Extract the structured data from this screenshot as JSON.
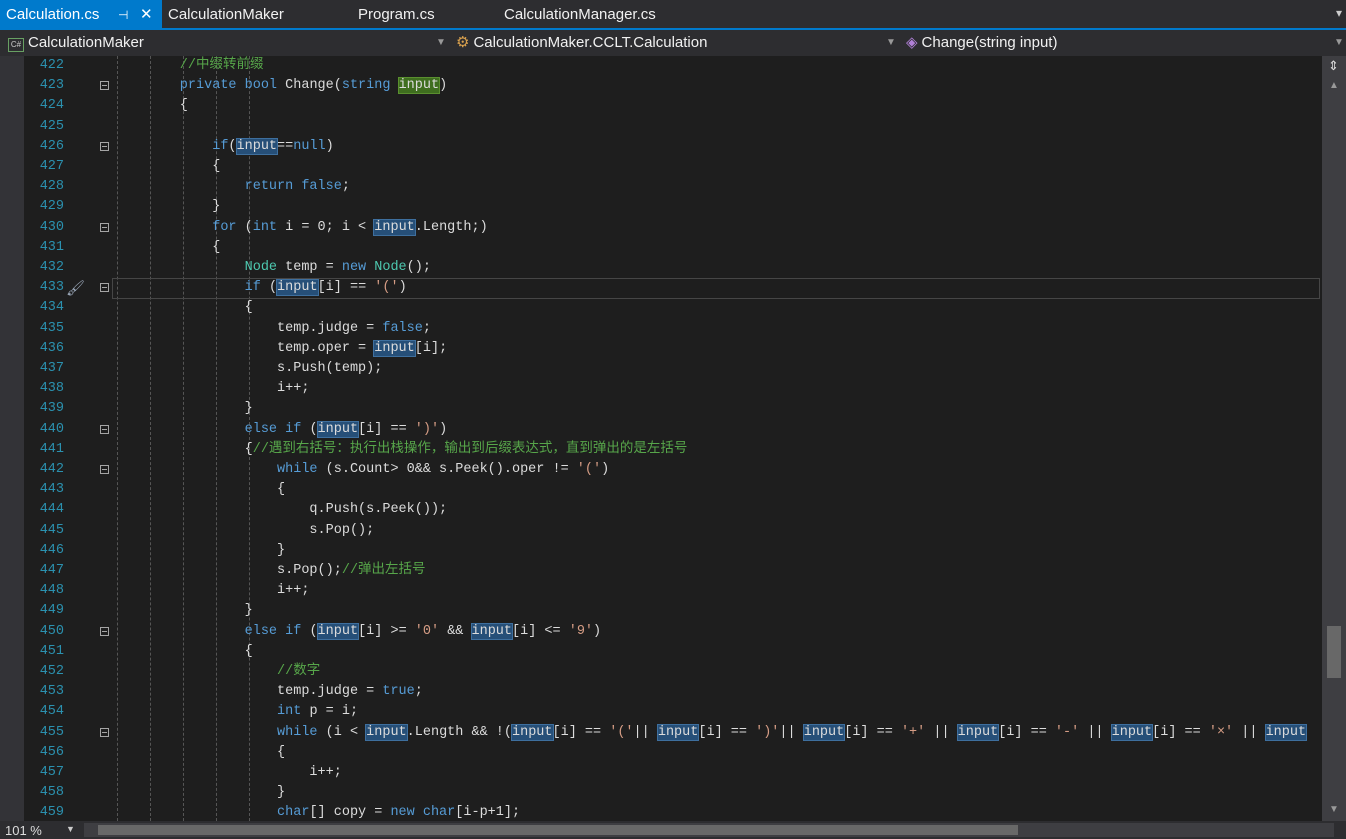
{
  "tabs": [
    {
      "label": "Calculation.cs",
      "active": true
    },
    {
      "label": "CalculationMaker"
    },
    {
      "label": "Program.cs"
    },
    {
      "label": "CalculationManager.cs"
    }
  ],
  "tab_icons": {
    "pin": "pin-icon",
    "close": "close-icon"
  },
  "navbar": {
    "project": "CalculationMaker",
    "class": "CalculationMaker.CCLT.Calculation",
    "member": "Change(string input)"
  },
  "colors": {
    "accent": "#007acc",
    "keyword": "#569cd6",
    "comment": "#57a64a",
    "type": "#4ec9b0",
    "string": "#d69d85",
    "line_number": "#2b91af"
  },
  "current_line": 433,
  "lines": [
    {
      "n": 422,
      "t": [
        [
          "c",
          "        //中缀转前缀"
        ]
      ]
    },
    {
      "n": 423,
      "f": 1,
      "t": [
        [
          "k",
          "        private bool "
        ],
        [
          "p",
          "Change("
        ],
        [
          "k",
          "string "
        ],
        [
          "hg",
          "input"
        ],
        [
          "p",
          ")"
        ]
      ]
    },
    {
      "n": 424,
      "t": [
        [
          "p",
          "        {"
        ]
      ]
    },
    {
      "n": 425,
      "t": []
    },
    {
      "n": 426,
      "f": 1,
      "t": [
        [
          "k",
          "            if"
        ],
        [
          "p",
          "("
        ],
        [
          "h",
          "input"
        ],
        [
          "p",
          "=="
        ],
        [
          "k",
          "null"
        ],
        [
          "p",
          ")"
        ]
      ]
    },
    {
      "n": 427,
      "t": [
        [
          "p",
          "            {"
        ]
      ]
    },
    {
      "n": 428,
      "t": [
        [
          "k",
          "                return false"
        ],
        [
          "p",
          ";"
        ]
      ]
    },
    {
      "n": 429,
      "t": [
        [
          "p",
          "            }"
        ]
      ]
    },
    {
      "n": 430,
      "f": 1,
      "t": [
        [
          "k",
          "            for "
        ],
        [
          "p",
          "("
        ],
        [
          "k",
          "int"
        ],
        [
          "p",
          " i = 0; i < "
        ],
        [
          "h",
          "input"
        ],
        [
          "p",
          ".Length;)"
        ]
      ]
    },
    {
      "n": 431,
      "t": [
        [
          "p",
          "            {"
        ]
      ]
    },
    {
      "n": 432,
      "t": [
        [
          "t",
          "                Node"
        ],
        [
          "p",
          " temp = "
        ],
        [
          "k",
          "new "
        ],
        [
          "t",
          "Node"
        ],
        [
          "p",
          "();"
        ]
      ]
    },
    {
      "n": 433,
      "f": 1,
      "t": [
        [
          "k",
          "                if "
        ],
        [
          "p",
          "("
        ],
        [
          "h",
          "input"
        ],
        [
          "p",
          "[i] == "
        ],
        [
          "s",
          "'('"
        ],
        [
          "p",
          ")"
        ]
      ]
    },
    {
      "n": 434,
      "t": [
        [
          "p",
          "                {"
        ]
      ]
    },
    {
      "n": 435,
      "t": [
        [
          "p",
          "                    temp.judge = "
        ],
        [
          "k",
          "false"
        ],
        [
          "p",
          ";"
        ]
      ]
    },
    {
      "n": 436,
      "t": [
        [
          "p",
          "                    temp.oper = "
        ],
        [
          "h",
          "input"
        ],
        [
          "p",
          "[i];"
        ]
      ]
    },
    {
      "n": 437,
      "t": [
        [
          "p",
          "                    s.Push(temp);"
        ]
      ]
    },
    {
      "n": 438,
      "t": [
        [
          "p",
          "                    i++;"
        ]
      ]
    },
    {
      "n": 439,
      "t": [
        [
          "p",
          "                }"
        ]
      ]
    },
    {
      "n": 440,
      "f": 1,
      "t": [
        [
          "k",
          "                else if "
        ],
        [
          "p",
          "("
        ],
        [
          "h",
          "input"
        ],
        [
          "p",
          "[i] == "
        ],
        [
          "s",
          "')'"
        ],
        [
          "p",
          ")"
        ]
      ]
    },
    {
      "n": 441,
      "t": [
        [
          "p",
          "                {"
        ],
        [
          "c",
          "//遇到右括号：执行出栈操作，输出到后缀表达式，直到弹出的是左括号"
        ]
      ]
    },
    {
      "n": 442,
      "f": 1,
      "t": [
        [
          "k",
          "                    while "
        ],
        [
          "p",
          "(s.Count> 0&& s.Peek().oper != "
        ],
        [
          "s",
          "'('"
        ],
        [
          "p",
          ")"
        ]
      ]
    },
    {
      "n": 443,
      "t": [
        [
          "p",
          "                    {"
        ]
      ]
    },
    {
      "n": 444,
      "t": [
        [
          "p",
          "                        q.Push(s.Peek());"
        ]
      ]
    },
    {
      "n": 445,
      "t": [
        [
          "p",
          "                        s.Pop();"
        ]
      ]
    },
    {
      "n": 446,
      "t": [
        [
          "p",
          "                    }"
        ]
      ]
    },
    {
      "n": 447,
      "t": [
        [
          "p",
          "                    s.Pop();"
        ],
        [
          "c",
          "//弹出左括号"
        ]
      ]
    },
    {
      "n": 448,
      "t": [
        [
          "p",
          "                    i++;"
        ]
      ]
    },
    {
      "n": 449,
      "t": [
        [
          "p",
          "                }"
        ]
      ]
    },
    {
      "n": 450,
      "f": 1,
      "t": [
        [
          "k",
          "                else if "
        ],
        [
          "p",
          "("
        ],
        [
          "h",
          "input"
        ],
        [
          "p",
          "[i] >= "
        ],
        [
          "s",
          "'0'"
        ],
        [
          "p",
          " && "
        ],
        [
          "h",
          "input"
        ],
        [
          "p",
          "[i] <= "
        ],
        [
          "s",
          "'9'"
        ],
        [
          "p",
          ")"
        ]
      ]
    },
    {
      "n": 451,
      "t": [
        [
          "p",
          "                {"
        ]
      ]
    },
    {
      "n": 452,
      "t": [
        [
          "c",
          "                    //数字"
        ]
      ]
    },
    {
      "n": 453,
      "t": [
        [
          "p",
          "                    temp.judge = "
        ],
        [
          "k",
          "true"
        ],
        [
          "p",
          ";"
        ]
      ]
    },
    {
      "n": 454,
      "t": [
        [
          "k",
          "                    int"
        ],
        [
          "p",
          " p = i;"
        ]
      ]
    },
    {
      "n": 455,
      "f": 1,
      "t": [
        [
          "k",
          "                    while "
        ],
        [
          "p",
          "(i < "
        ],
        [
          "h",
          "input"
        ],
        [
          "p",
          ".Length && !("
        ],
        [
          "h",
          "input"
        ],
        [
          "p",
          "[i] == "
        ],
        [
          "s",
          "'('"
        ],
        [
          "p",
          "|| "
        ],
        [
          "h",
          "input"
        ],
        [
          "p",
          "[i] == "
        ],
        [
          "s",
          "')'"
        ],
        [
          "p",
          "|| "
        ],
        [
          "h",
          "input"
        ],
        [
          "p",
          "[i] == "
        ],
        [
          "s",
          "'+'"
        ],
        [
          "p",
          " || "
        ],
        [
          "h",
          "input"
        ],
        [
          "p",
          "[i] == "
        ],
        [
          "s",
          "'-'"
        ],
        [
          "p",
          " || "
        ],
        [
          "h",
          "input"
        ],
        [
          "p",
          "[i] == "
        ],
        [
          "s",
          "'×'"
        ],
        [
          "p",
          " || "
        ],
        [
          "h",
          "input"
        ]
      ]
    },
    {
      "n": 456,
      "t": [
        [
          "p",
          "                    {"
        ]
      ]
    },
    {
      "n": 457,
      "t": [
        [
          "p",
          "                        i++;"
        ]
      ]
    },
    {
      "n": 458,
      "t": [
        [
          "p",
          "                    }"
        ]
      ]
    },
    {
      "n": 459,
      "t": [
        [
          "k",
          "                    char"
        ],
        [
          "p",
          "[] copy = "
        ],
        [
          "k",
          "new char"
        ],
        [
          "p",
          "[i-p+1];"
        ]
      ]
    }
  ],
  "status": {
    "zoom": "101 %"
  }
}
